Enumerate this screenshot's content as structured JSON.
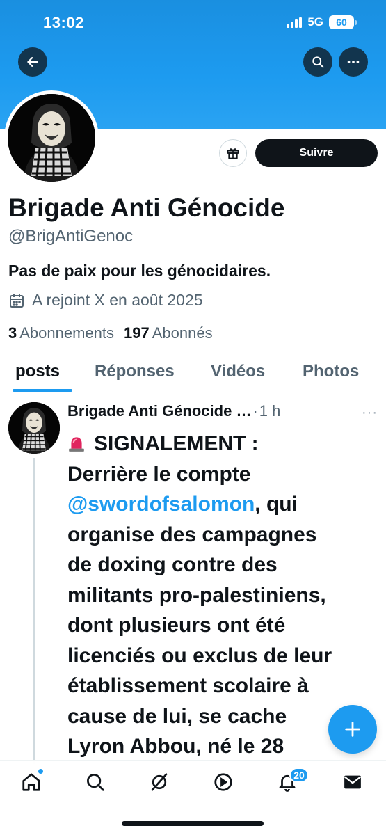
{
  "status_bar": {
    "time": "13:02",
    "network": "5G",
    "battery": "60"
  },
  "colors": {
    "accent": "#1d9bf0",
    "text": "#0f1419",
    "secondary": "#536471",
    "banner": "#1d9bf0"
  },
  "header": {
    "back_icon": "arrow-left-icon",
    "search_icon": "search-icon",
    "more_icon": "more-horizontal-icon"
  },
  "profile": {
    "display_name": "Brigade Anti Génocide",
    "handle": "@BrigAntiGenoc",
    "bio": "Pas de paix pour les génocidaires.",
    "joined": "A rejoint X en août 2025",
    "following_count": "3",
    "following_label": "Abonnements",
    "followers_count": "197",
    "followers_label": "Abonnés",
    "follow_button": "Suivre",
    "gift_icon": "gift-icon"
  },
  "tabs": [
    {
      "label": "posts",
      "active": true
    },
    {
      "label": "Réponses",
      "active": false
    },
    {
      "label": "Vidéos",
      "active": false
    },
    {
      "label": "Photos",
      "active": false
    }
  ],
  "tweet": {
    "author": "Brigade Anti Génocide …",
    "dot": "·",
    "time": "1 h",
    "more": "···",
    "lines": {
      "l1": "SIGNALEMENT :",
      "l2": "Derrière le compte",
      "l3_mention": "@swordofsalomon",
      "l3_rest": ", qui",
      "l4": "organise des campagnes",
      "l5": "de doxing contre des",
      "l6": "militants pro-palestiniens,",
      "l7": "dont plusieurs ont été",
      "l8": "licenciés ou exclus de leur",
      "l9": "établissement scolaire à",
      "l10": "cause de lui, se cache",
      "l11": "Lyron Abbou, né le 28"
    }
  },
  "bottom_nav": {
    "items": [
      "home-icon",
      "search-icon",
      "grok-icon",
      "video-icon",
      "notifications-icon",
      "messages-icon"
    ],
    "notif_badge": "20"
  }
}
